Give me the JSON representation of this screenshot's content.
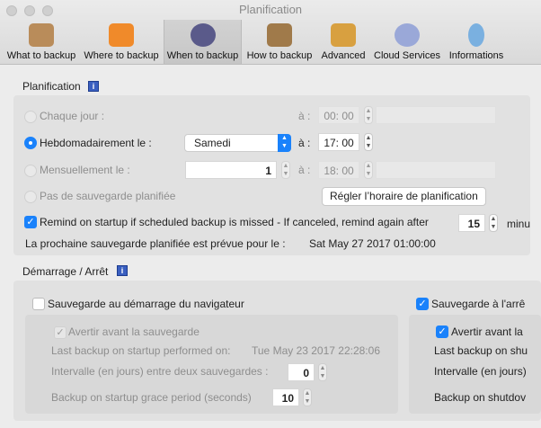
{
  "window": {
    "title": "Planification"
  },
  "toolbar": {
    "tabs": [
      {
        "label": "What to backup",
        "icon": "backup-box-icon",
        "color": "#b98c5a"
      },
      {
        "label": "Where to backup",
        "icon": "folder-icon",
        "color": "#f08a2a"
      },
      {
        "label": "When to backup",
        "icon": "clock-icon",
        "color": "#5a5a8a",
        "selected": true
      },
      {
        "label": "How to backup",
        "icon": "clipboard-check-icon",
        "color": "#a07a4a"
      },
      {
        "label": "Advanced",
        "icon": "folder-tools-icon",
        "color": "#d8a040"
      },
      {
        "label": "Cloud Services",
        "icon": "cloud-network-icon",
        "color": "#9aa8d8"
      },
      {
        "label": "Informations",
        "icon": "lightbulb-icon",
        "color": "#7ab0e0"
      }
    ]
  },
  "schedule": {
    "title": "Planification",
    "daily": {
      "label": "Chaque jour :",
      "at": "à :",
      "time": "00: 00"
    },
    "weekly": {
      "label": "Hebdomadairement le :",
      "day": "Samedi",
      "at": "à :",
      "time": "17: 00",
      "selected": true
    },
    "monthly": {
      "label": "Mensuellement le :",
      "day": "1",
      "at": "à :",
      "time": "18: 00"
    },
    "none": {
      "label": "Pas de sauvegarde planifiée"
    },
    "set_button": "Régler l’horaire de planification",
    "remind": {
      "label": "Remind on startup if scheduled backup is missed - If canceled, remind again after",
      "value": "15",
      "unit": "minu",
      "checked": true
    },
    "next": {
      "label": "La prochaine sauvegarde planifiée est prévue pour le :",
      "value": "Sat May 27 2017 01:00:00"
    }
  },
  "startstop": {
    "title": "Démarrage / Arrêt",
    "startup": {
      "label": "Sauvegarde au démarrage du navigateur",
      "checked": false,
      "warn": "Avertir avant la sauvegarde",
      "last_label": "Last backup on startup performed on:",
      "last_value": "Tue May 23 2017 22:28:06",
      "interval_label": "Intervalle (en jours) entre deux sauvegardes :",
      "interval": "0",
      "grace_label": "Backup on startup grace period (seconds)",
      "grace": "10"
    },
    "shutdown": {
      "label": "Sauvegarde à l'arrê",
      "checked": true,
      "warn": "Avertir avant la",
      "last_label": "Last backup on shu",
      "interval_label": "Intervalle (en jours)",
      "grace_label": "Backup on shutdov"
    }
  }
}
